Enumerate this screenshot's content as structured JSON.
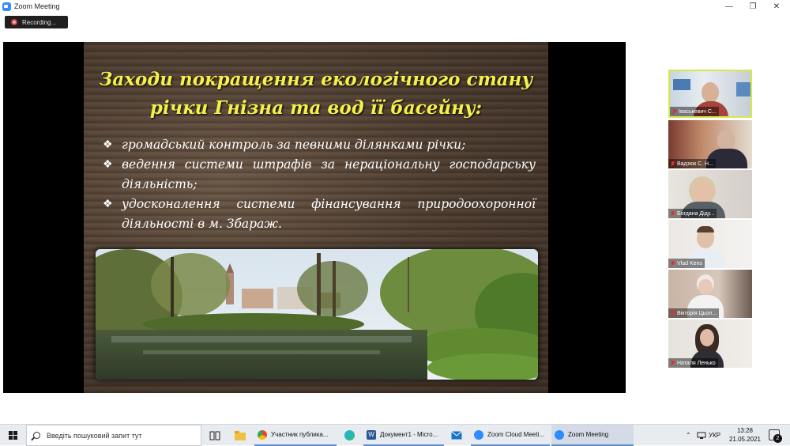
{
  "window": {
    "title": "Zoom Meeting",
    "minimize_glyph": "—",
    "maximize_glyph": "❐",
    "close_glyph": "✕"
  },
  "recording": {
    "label": "Recording..."
  },
  "slide": {
    "title_line1": "Заходи покращення екологічного стану",
    "title_line2": "річки Гнізна  та вод її басейну:",
    "bullet_glyph": "❖",
    "bullets": [
      "громадський контроль за певними ділянками річки;",
      "ведення системи штрафів за нераціональну господарську діяльність;",
      "удосконалення  системи фінансування природоохоронної діяльності в м. Збараж."
    ],
    "title_color": "#f5f04a"
  },
  "participants": [
    {
      "name": "Іваськевич С..."
    },
    {
      "name": "Вадзюк С. Н..."
    },
    {
      "name": "Богдана Діду..."
    },
    {
      "name": "Vlad Kens"
    },
    {
      "name": "Вікторія Цьол..."
    },
    {
      "name": "Наталя Ленько"
    }
  ],
  "taskbar": {
    "search_placeholder": "Введіть пошуковий запит тут",
    "apps": [
      {
        "label": "Участник публика..."
      },
      {
        "label": "Документ1 - Micro..."
      },
      {
        "label": "Zoom Cloud Meeti..."
      },
      {
        "label": "Zoom Meeting"
      }
    ],
    "tray_chevron": "⌃",
    "language": "УКР",
    "time": "13:28",
    "date": "21.05.2021",
    "notifications": "2"
  },
  "colors": {
    "active_speaker_border": "#d8e84a",
    "muted_icon": "#e03030",
    "zoom_blue": "#2d8cff"
  }
}
